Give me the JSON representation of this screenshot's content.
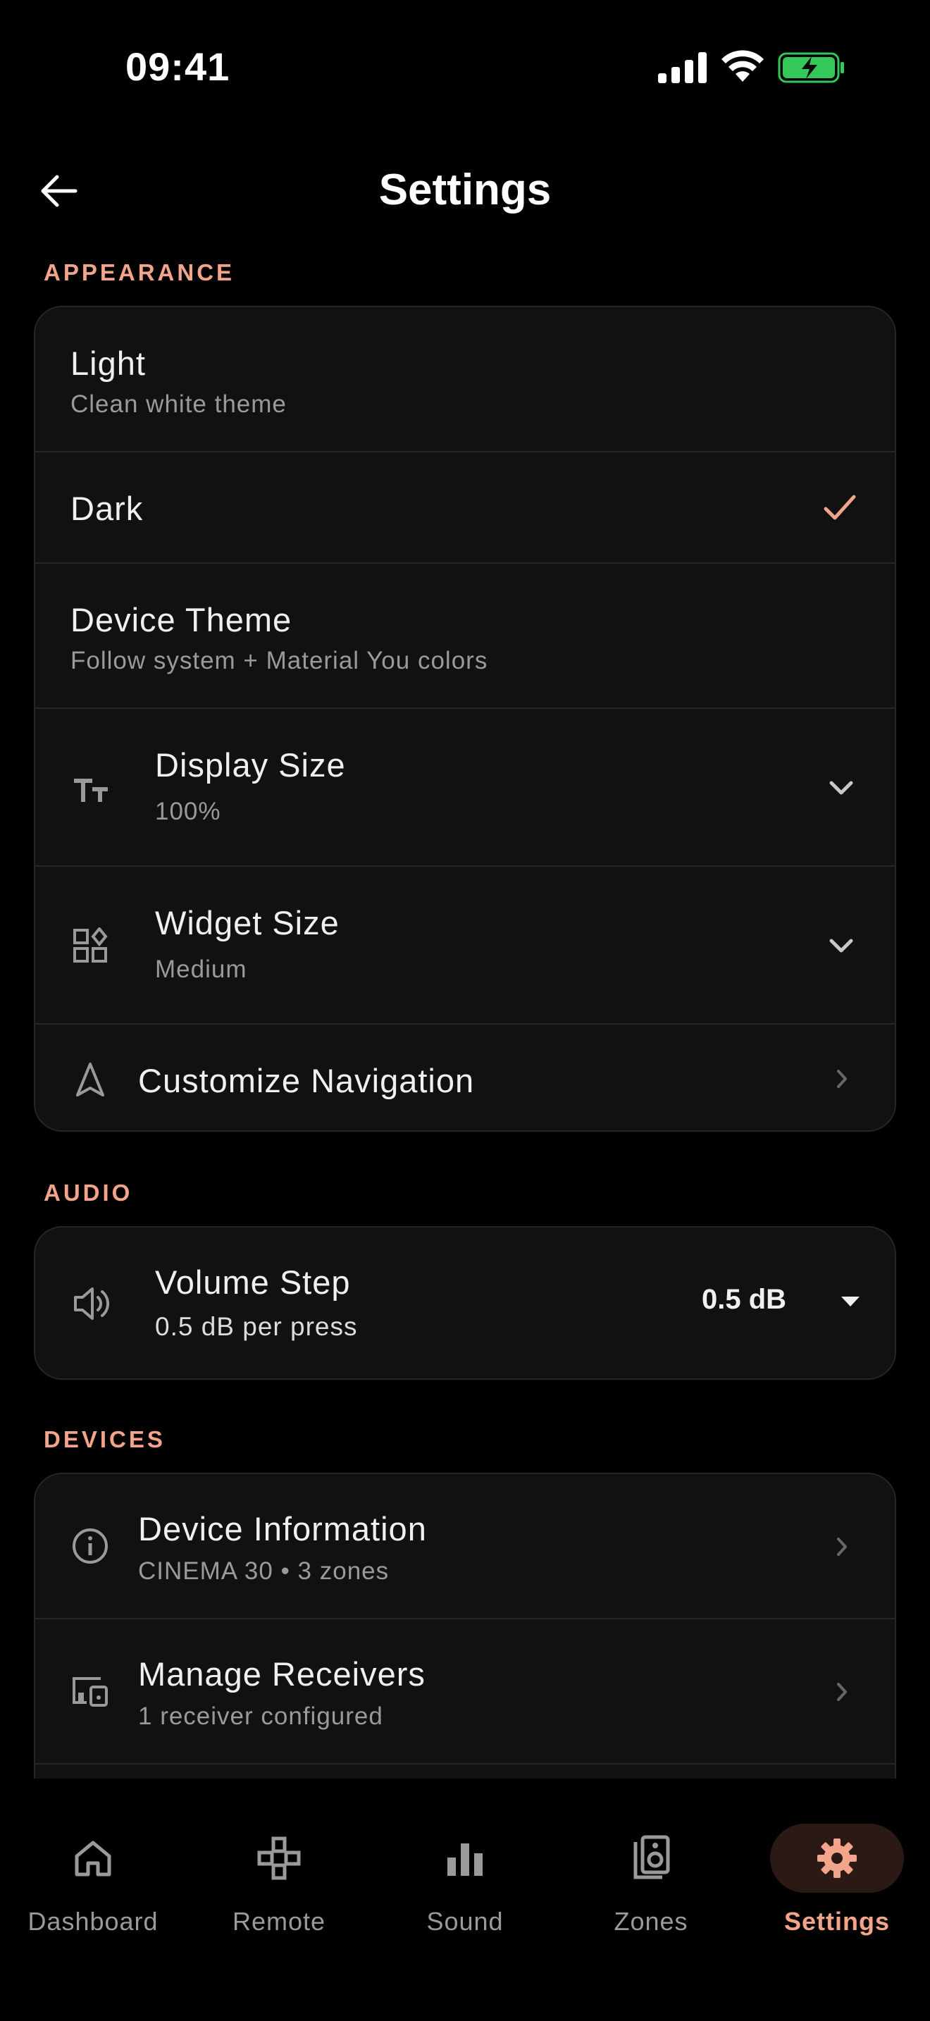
{
  "status_bar": {
    "time": "09:41"
  },
  "header": {
    "title": "Settings"
  },
  "sections": {
    "appearance": {
      "label": "APPEARANCE",
      "rows": {
        "light": {
          "title": "Light",
          "subtitle": "Clean white theme"
        },
        "dark": {
          "title": "Dark",
          "selected": true
        },
        "device_theme": {
          "title": "Device Theme",
          "subtitle": "Follow system + Material You colors"
        },
        "display_size": {
          "title": "Display Size",
          "subtitle": "100%"
        },
        "widget_size": {
          "title": "Widget Size",
          "subtitle": "Medium"
        },
        "customize_navigation": {
          "title": "Customize Navigation"
        }
      }
    },
    "audio": {
      "label": "AUDIO",
      "rows": {
        "volume_step": {
          "title": "Volume Step",
          "subtitle": "0.5 dB per press",
          "value": "0.5 dB"
        }
      }
    },
    "devices": {
      "label": "DEVICES",
      "rows": {
        "device_information": {
          "title": "Device Information",
          "subtitle": "CINEMA 30 • 3 zones"
        },
        "manage_receivers": {
          "title": "Manage Receivers",
          "subtitle": "1 receiver configured"
        }
      }
    }
  },
  "nav": {
    "items": [
      {
        "label": "Dashboard",
        "icon": "home-icon"
      },
      {
        "label": "Remote",
        "icon": "gamepad-icon"
      },
      {
        "label": "Sound",
        "icon": "bar-chart-icon"
      },
      {
        "label": "Zones",
        "icon": "speaker-icon"
      },
      {
        "label": "Settings",
        "icon": "gear-icon",
        "active": true
      }
    ]
  },
  "colors": {
    "accent": "#f2a58a",
    "background": "#000000",
    "card": "#111111",
    "divider": "#262626",
    "battery": "#34c759"
  }
}
